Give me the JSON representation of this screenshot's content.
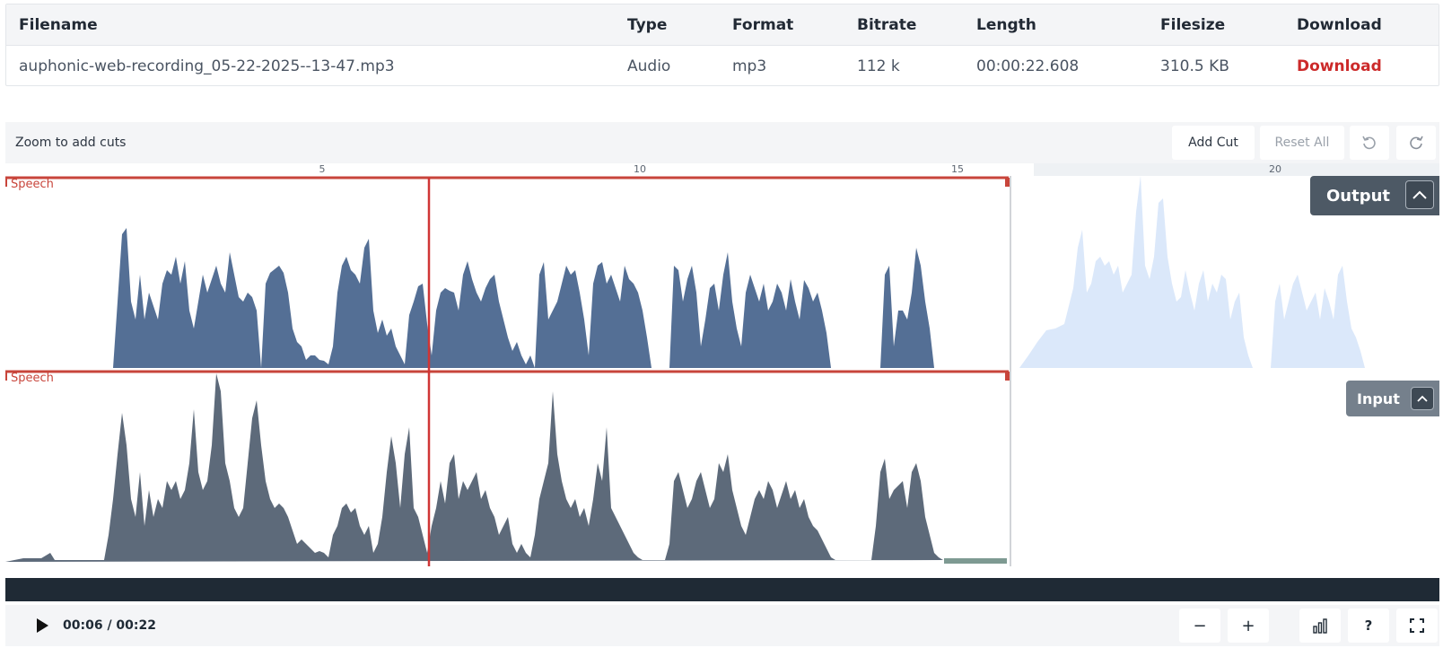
{
  "file_table": {
    "headers": [
      "Filename",
      "Type",
      "Format",
      "Bitrate",
      "Length",
      "Filesize",
      "Download"
    ],
    "rows": [
      [
        "auphonic-web-recording_05-22-2025--13-47.mp3",
        "Audio",
        "mp3",
        "112 k",
        "00:00:22.608",
        "310.5 KB",
        "Download"
      ]
    ]
  },
  "editor": {
    "zoom_hint": "Zoom to add cuts",
    "add_cut": "Add Cut",
    "reset_all": "Reset All",
    "undo_icon": "undo-icon",
    "redo_icon": "redo-icon",
    "ruler_ticks": [
      "5",
      "10",
      "15",
      "20"
    ],
    "speech_label": "Speech",
    "output_label": "Output",
    "input_label": "Input"
  },
  "player": {
    "time": "00:06 / 00:22",
    "zoom_out": "−",
    "zoom_in": "+",
    "help": "?",
    "icons": [
      "play-icon",
      "zoom-out-icon",
      "zoom-in-icon",
      "levels-icon",
      "help-icon",
      "fullscreen-icon"
    ]
  },
  "colors": {
    "output_wave": "#546f95",
    "output_wave_faded": "#dbe8fa",
    "input_wave": "#5d6a7a",
    "cut_region": "#c8453b",
    "playhead": "#d03535",
    "download_link": "#cc2a2a"
  }
}
